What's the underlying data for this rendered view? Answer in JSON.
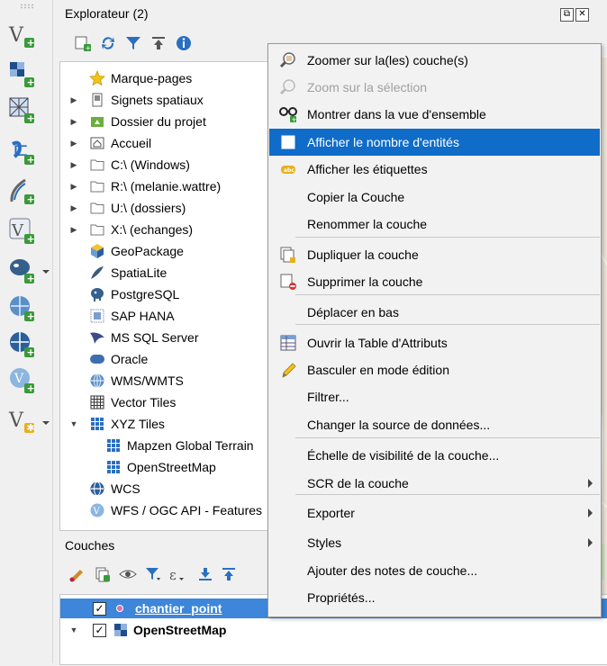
{
  "left_toolbar": {
    "icons": [
      "add-vector-layer-icon",
      "add-raster-layer-icon",
      "add-mesh-layer-icon",
      "add-delimited-text-icon",
      "add-gps-icon",
      "add-virtual-layer-icon",
      "add-postgis-icon",
      "add-wms-icon",
      "add-wfs-icon",
      "add-wcs-icon",
      "new-shapefile-icon"
    ]
  },
  "explorer": {
    "title": "Explorateur (2)",
    "tree": [
      {
        "label": "Marque-pages",
        "icon": "star-icon",
        "expander": false
      },
      {
        "label": "Signets spatiaux",
        "icon": "bookmark-icon",
        "expander": true
      },
      {
        "label": "Dossier du projet",
        "icon": "project-folder-icon",
        "expander": true
      },
      {
        "label": "Accueil",
        "icon": "home-icon",
        "expander": true
      },
      {
        "label": "C:\\ (Windows)",
        "icon": "folder-icon",
        "expander": true
      },
      {
        "label": "R:\\ (melanie.wattre)",
        "icon": "folder-icon",
        "expander": true
      },
      {
        "label": "U:\\ (dossiers)",
        "icon": "folder-icon",
        "expander": true
      },
      {
        "label": "X:\\ (echanges)",
        "icon": "folder-icon",
        "expander": true
      },
      {
        "label": "GeoPackage",
        "icon": "geopackage-icon",
        "expander": false
      },
      {
        "label": "SpatiaLite",
        "icon": "spatialite-icon",
        "expander": false
      },
      {
        "label": "PostgreSQL",
        "icon": "postgresql-icon",
        "expander": false
      },
      {
        "label": "SAP HANA",
        "icon": "sap-hana-icon",
        "expander": false
      },
      {
        "label": "MS SQL Server",
        "icon": "mssql-icon",
        "expander": false
      },
      {
        "label": "Oracle",
        "icon": "oracle-icon",
        "expander": false
      },
      {
        "label": "WMS/WMTS",
        "icon": "wms-icon",
        "expander": false
      },
      {
        "label": "Vector Tiles",
        "icon": "vector-tiles-icon",
        "expander": false
      },
      {
        "label": "XYZ Tiles",
        "icon": "xyz-tiles-icon",
        "expander": "open"
      },
      {
        "label": "Mapzen Global Terrain",
        "icon": "xyz-tiles-icon",
        "expander": false,
        "child": true
      },
      {
        "label": "OpenStreetMap",
        "icon": "xyz-tiles-icon",
        "expander": false,
        "child": true
      },
      {
        "label": "WCS",
        "icon": "wcs-icon",
        "expander": false
      },
      {
        "label": "WFS / OGC API - Features",
        "icon": "wfs-icon",
        "expander": false
      }
    ]
  },
  "layers": {
    "title": "Couches",
    "items": [
      {
        "name": "chantier_point",
        "checked": true,
        "selected": true
      },
      {
        "name": "OpenStreetMap",
        "checked": true,
        "selected": false
      }
    ]
  },
  "context_menu": {
    "items": [
      {
        "label": "Zoomer sur la(les) couche(s)",
        "icon": "zoom-layer-icon"
      },
      {
        "label": "Zoom sur la sélection",
        "icon": "zoom-selection-icon",
        "disabled": true
      },
      {
        "label": "Montrer dans la vue d'ensemble",
        "icon": "overview-icon"
      },
      {
        "label": "Afficher le nombre d'entités",
        "icon": "checkbox-icon",
        "highlighted": true
      },
      {
        "label": "Afficher les étiquettes",
        "icon": "labels-icon"
      },
      {
        "label": "Copier la Couche",
        "icon": ""
      },
      {
        "label": "Renommer la couche",
        "icon": ""
      },
      {
        "label": "Dupliquer la couche",
        "icon": "duplicate-layer-icon"
      },
      {
        "label": "Supprimer la couche",
        "icon": "remove-layer-icon"
      },
      {
        "label": "Déplacer en bas",
        "icon": ""
      },
      {
        "label": "Ouvrir la Table d'Attributs",
        "icon": "attribute-table-icon"
      },
      {
        "label": "Basculer en mode édition",
        "icon": "toggle-editing-icon"
      },
      {
        "label": "Filtrer...",
        "icon": ""
      },
      {
        "label": "Changer la source de données...",
        "icon": ""
      },
      {
        "label": "Échelle de visibilité de la couche...",
        "icon": ""
      },
      {
        "label": "SCR de la couche",
        "icon": "",
        "submenu": true
      },
      {
        "label": "Exporter",
        "icon": "",
        "submenu": true
      },
      {
        "label": "Styles",
        "icon": "",
        "submenu": true
      },
      {
        "label": "Ajouter des notes de couche...",
        "icon": ""
      },
      {
        "label": "Propriétés...",
        "icon": ""
      }
    ]
  }
}
